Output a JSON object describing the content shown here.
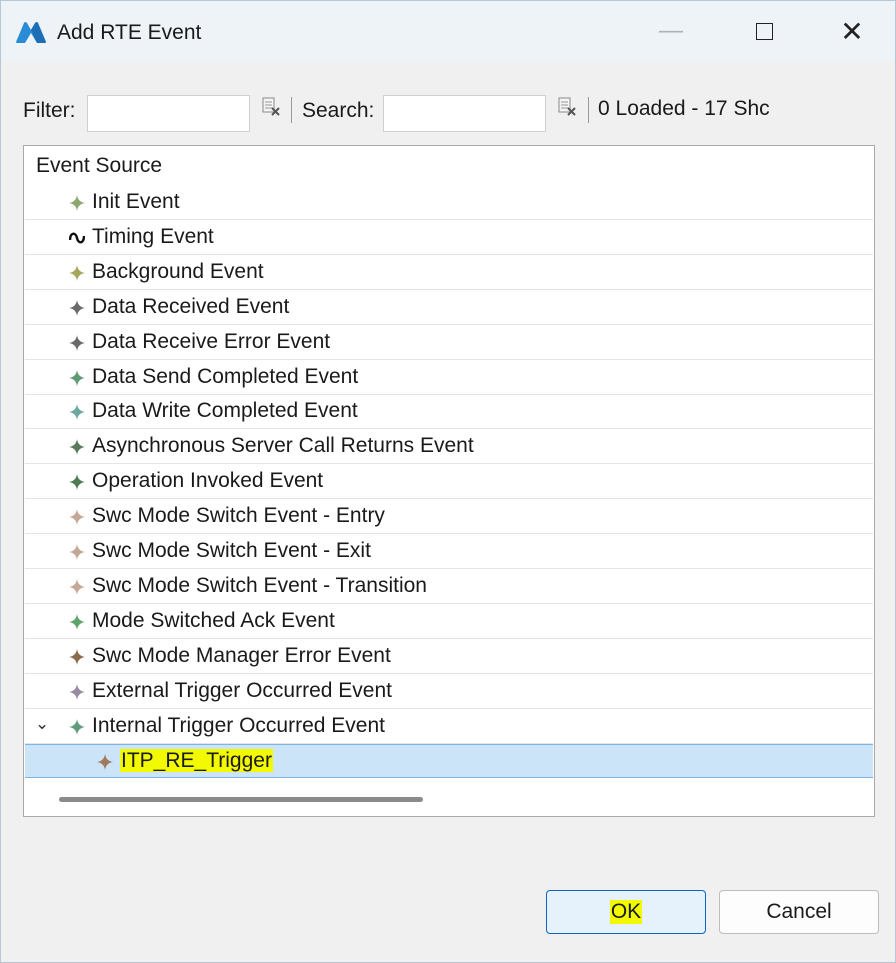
{
  "window": {
    "title": "Add RTE Event",
    "minimize_glyph": "—",
    "close_glyph": "✕"
  },
  "toolbar": {
    "filter_label": "Filter:",
    "filter_value": "",
    "search_label": "Search:",
    "search_value": "",
    "status_text": "0 Loaded - 17 Shc"
  },
  "tree": {
    "header": "Event Source",
    "items": [
      {
        "label": "Init Event",
        "icon": "event-diamond-icon",
        "color": "#8aa870"
      },
      {
        "label": "Timing Event",
        "icon": "timing-wave-icon",
        "color": "#111111"
      },
      {
        "label": "Background Event",
        "icon": "event-diamond-icon",
        "color": "#a6a65c"
      },
      {
        "label": "Data Received Event",
        "icon": "event-diamond-icon",
        "color": "#6a6a6a"
      },
      {
        "label": "Data Receive Error Event",
        "icon": "event-diamond-icon",
        "color": "#6a6a6a"
      },
      {
        "label": "Data Send Completed Event",
        "icon": "event-diamond-icon",
        "color": "#5f9a73"
      },
      {
        "label": "Data Write Completed Event",
        "icon": "event-diamond-icon",
        "color": "#6aa8a0"
      },
      {
        "label": "Asynchronous Server Call Returns Event",
        "icon": "event-diamond-icon",
        "color": "#5a7a5a"
      },
      {
        "label": "Operation Invoked Event",
        "icon": "event-diamond-icon",
        "color": "#4f7a54"
      },
      {
        "label": "Swc Mode Switch Event - Entry",
        "icon": "event-diamond-icon",
        "color": "#c4a897"
      },
      {
        "label": "Swc Mode Switch Event - Exit",
        "icon": "event-diamond-icon",
        "color": "#c4a897"
      },
      {
        "label": "Swc Mode Switch Event - Transition",
        "icon": "event-diamond-icon",
        "color": "#c4a897"
      },
      {
        "label": "Mode Switched Ack Event",
        "icon": "event-diamond-icon",
        "color": "#5fa36d"
      },
      {
        "label": "Swc Mode Manager Error Event",
        "icon": "event-diamond-icon",
        "color": "#8a6a4a"
      },
      {
        "label": "External Trigger Occurred Event",
        "icon": "event-diamond-icon",
        "color": "#9a8aa6"
      },
      {
        "label": "Internal Trigger Occurred Event",
        "icon": "event-diamond-icon",
        "color": "#5f9a7d",
        "expanded": true,
        "twisty": "⌄"
      },
      {
        "label": "ITP_RE_Trigger",
        "icon": "event-diamond-icon",
        "color": "#a07a5a",
        "child": true,
        "selected": true
      }
    ]
  },
  "buttons": {
    "ok_label": "OK",
    "cancel_label": "Cancel"
  },
  "colors": {
    "accent": "#0a66c2",
    "selection": "#cce4f7",
    "highlight": "#f3fa00"
  }
}
